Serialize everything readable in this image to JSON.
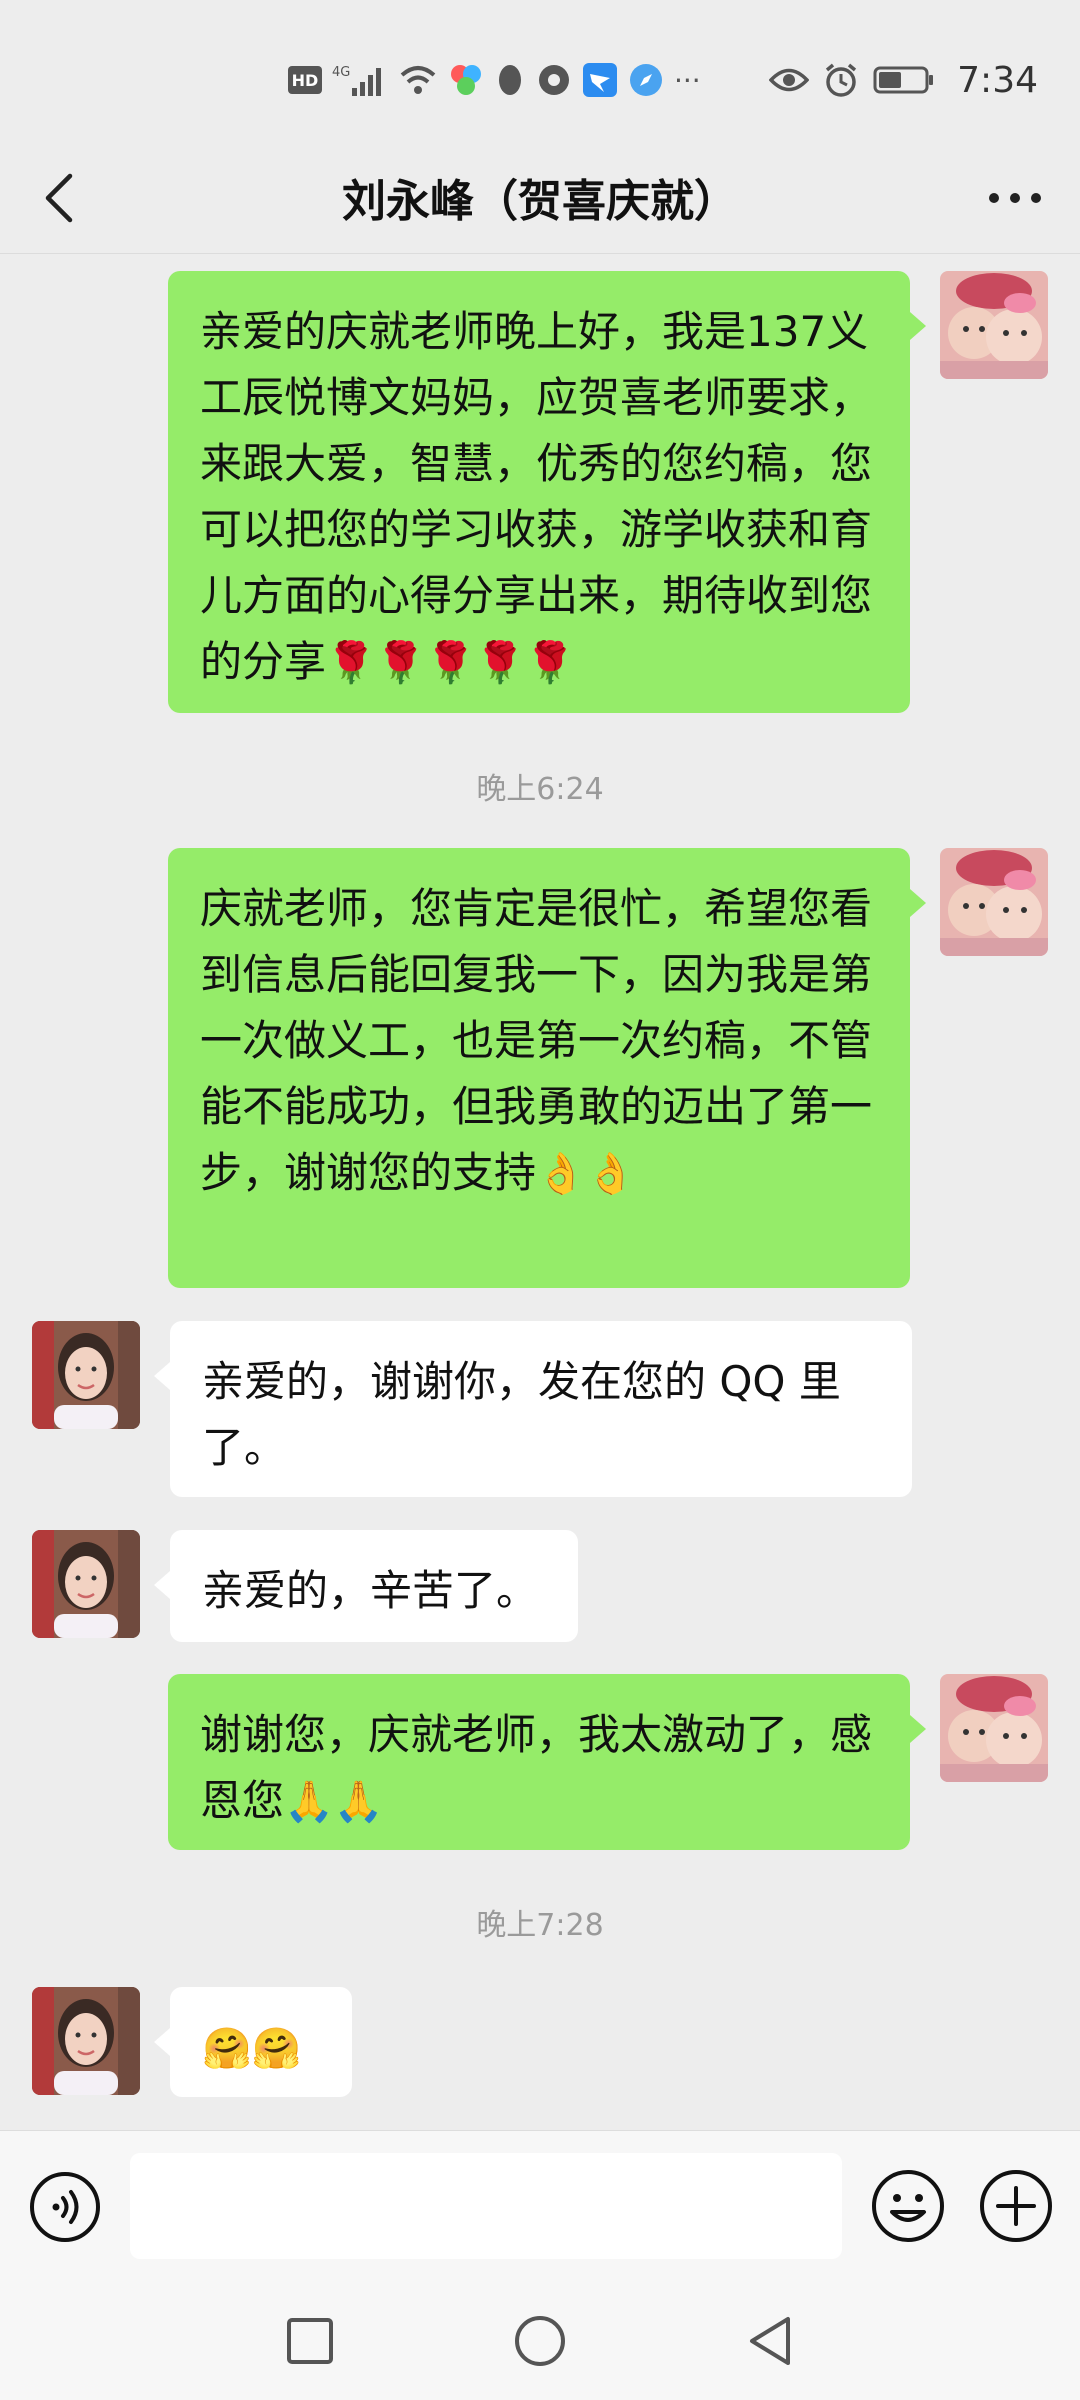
{
  "status_bar": {
    "network_label": "HD",
    "signal_label": "4G",
    "time": "7:34",
    "more_label": "···"
  },
  "header": {
    "title": "刘永峰（贺喜庆就）"
  },
  "messages": [
    {
      "sender": "me",
      "text": "亲爱的庆就老师晚上好，我是137义工辰悦博文妈妈，应贺喜老师要求，来跟大爱，智慧，优秀的您约稿，您可以把您的学习收获，游学收获和育儿方面的心得分享出来，期待收到您的分享",
      "emoji": "🌹🌹🌹🌹🌹"
    },
    {
      "type": "time",
      "text": "晚上6:24"
    },
    {
      "sender": "me",
      "text": "庆就老师，您肯定是很忙，希望您看到信息后能回复我一下，因为我是第一次做义工，也是第一次约稿，不管能不能成功，但我勇敢的迈出了第一步，谢谢您的支持",
      "emoji": "👌👌"
    },
    {
      "sender": "other",
      "text": "亲爱的，谢谢你，发在您的 QQ 里了。"
    },
    {
      "sender": "other",
      "text": "亲爱的，辛苦了。"
    },
    {
      "sender": "me",
      "text": "谢谢您，庆就老师，我太激动了，感恩您",
      "emoji": "🙏🙏"
    },
    {
      "type": "time",
      "text": "晚上7:28"
    },
    {
      "sender": "other",
      "text": "",
      "emoji": "🤗🤗"
    }
  ],
  "colors": {
    "me_bubble": "#95ec69",
    "other_bubble": "#ffffff",
    "background": "#ededed"
  }
}
